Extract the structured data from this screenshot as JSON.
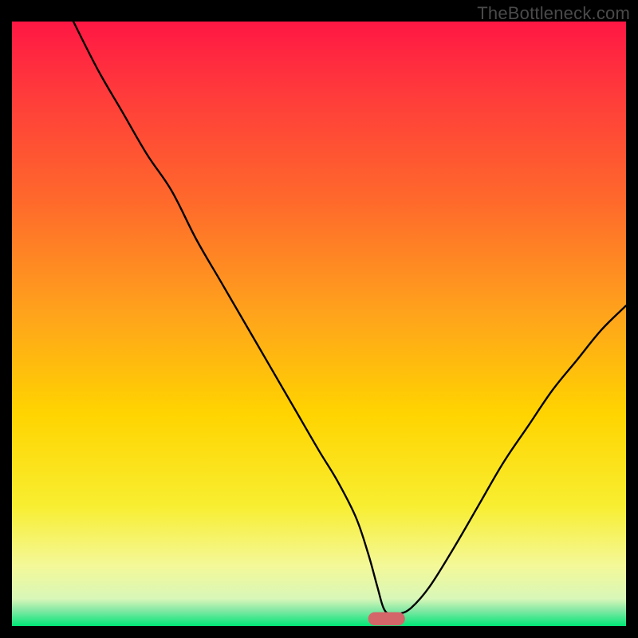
{
  "watermark": "TheBottleneck.com",
  "chart_data": {
    "type": "line",
    "title": "",
    "xlabel": "",
    "ylabel": "",
    "xlim": [
      0,
      100
    ],
    "ylim": [
      0,
      100
    ],
    "grid": false,
    "legend": false,
    "gradient": {
      "stops": [
        {
          "offset": 0.0,
          "color": "#ff1744"
        },
        {
          "offset": 0.12,
          "color": "#ff3b3b"
        },
        {
          "offset": 0.3,
          "color": "#ff6a2b"
        },
        {
          "offset": 0.48,
          "color": "#ffa21c"
        },
        {
          "offset": 0.65,
          "color": "#ffd400"
        },
        {
          "offset": 0.8,
          "color": "#f8ee30"
        },
        {
          "offset": 0.9,
          "color": "#f4f898"
        },
        {
          "offset": 0.955,
          "color": "#d8f7b8"
        },
        {
          "offset": 0.975,
          "color": "#7fe8a3"
        },
        {
          "offset": 1.0,
          "color": "#00e676"
        }
      ]
    },
    "marker": {
      "x": 61,
      "y": 1.2,
      "width": 6,
      "height": 2.2,
      "color": "#d4666a",
      "rx": 1.1
    },
    "series": [
      {
        "name": "bottleneck-curve",
        "color": "#000000",
        "stroke_width": 2.4,
        "x": [
          10,
          14,
          18,
          22,
          26,
          30,
          34,
          38,
          42,
          46,
          50,
          53,
          56,
          58,
          59.5,
          60.5,
          61.5,
          63,
          65,
          68,
          72,
          76,
          80,
          84,
          88,
          92,
          96,
          100
        ],
        "values": [
          100,
          92,
          85,
          78,
          72,
          64,
          57,
          50,
          43,
          36,
          29,
          24,
          18,
          12,
          6.5,
          3.0,
          2.0,
          2.0,
          3.0,
          6.5,
          13,
          20,
          27,
          33,
          39,
          44,
          49,
          53
        ]
      }
    ]
  }
}
